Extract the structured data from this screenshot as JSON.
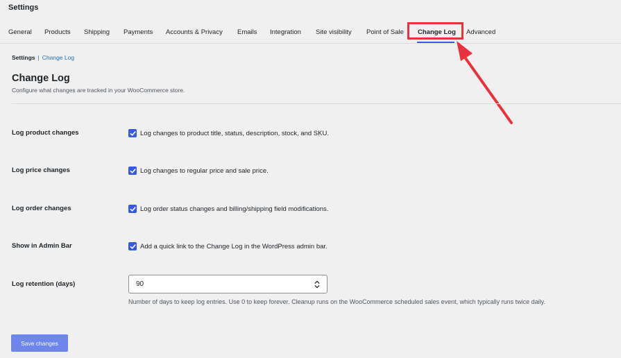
{
  "page": {
    "title": "Settings"
  },
  "tabs": [
    {
      "label": "General"
    },
    {
      "label": "Products"
    },
    {
      "label": "Shipping"
    },
    {
      "label": "Payments"
    },
    {
      "label": "Accounts & Privacy"
    },
    {
      "label": "Emails"
    },
    {
      "label": "Integration"
    },
    {
      "label": "Site visibility"
    },
    {
      "label": "Point of Sale"
    },
    {
      "label": "Change Log",
      "active": true
    },
    {
      "label": "Advanced"
    }
  ],
  "breadcrumb": {
    "current": "Settings",
    "separator": "|",
    "link": "Change Log"
  },
  "section": {
    "title": "Change Log",
    "description": "Configure what changes are tracked in your WooCommerce store."
  },
  "settings": [
    {
      "label": "Log product changes",
      "checked": true,
      "text": "Log changes to product title, status, description, stock, and SKU."
    },
    {
      "label": "Log price changes",
      "checked": true,
      "text": "Log changes to regular price and sale price."
    },
    {
      "label": "Log order changes",
      "checked": true,
      "text": "Log order status changes and billing/shipping field modifications."
    },
    {
      "label": "Show in Admin Bar",
      "checked": true,
      "text": "Add a quick link to the Change Log in the WordPress admin bar."
    }
  ],
  "retention": {
    "label": "Log retention (days)",
    "value": "90",
    "help": "Number of days to keep log entries. Use 0 to keep forever. Cleanup runs on the WooCommerce scheduled sales event, which typically runs twice daily."
  },
  "actions": {
    "save_label": "Save changes"
  },
  "colors": {
    "accent": "#3858e9",
    "annotation": "#e8323e"
  },
  "icons": {
    "checkbox": "checkmark-icon",
    "stepper": "chevron-up-down-icon",
    "annotation": "arrow-icon"
  }
}
